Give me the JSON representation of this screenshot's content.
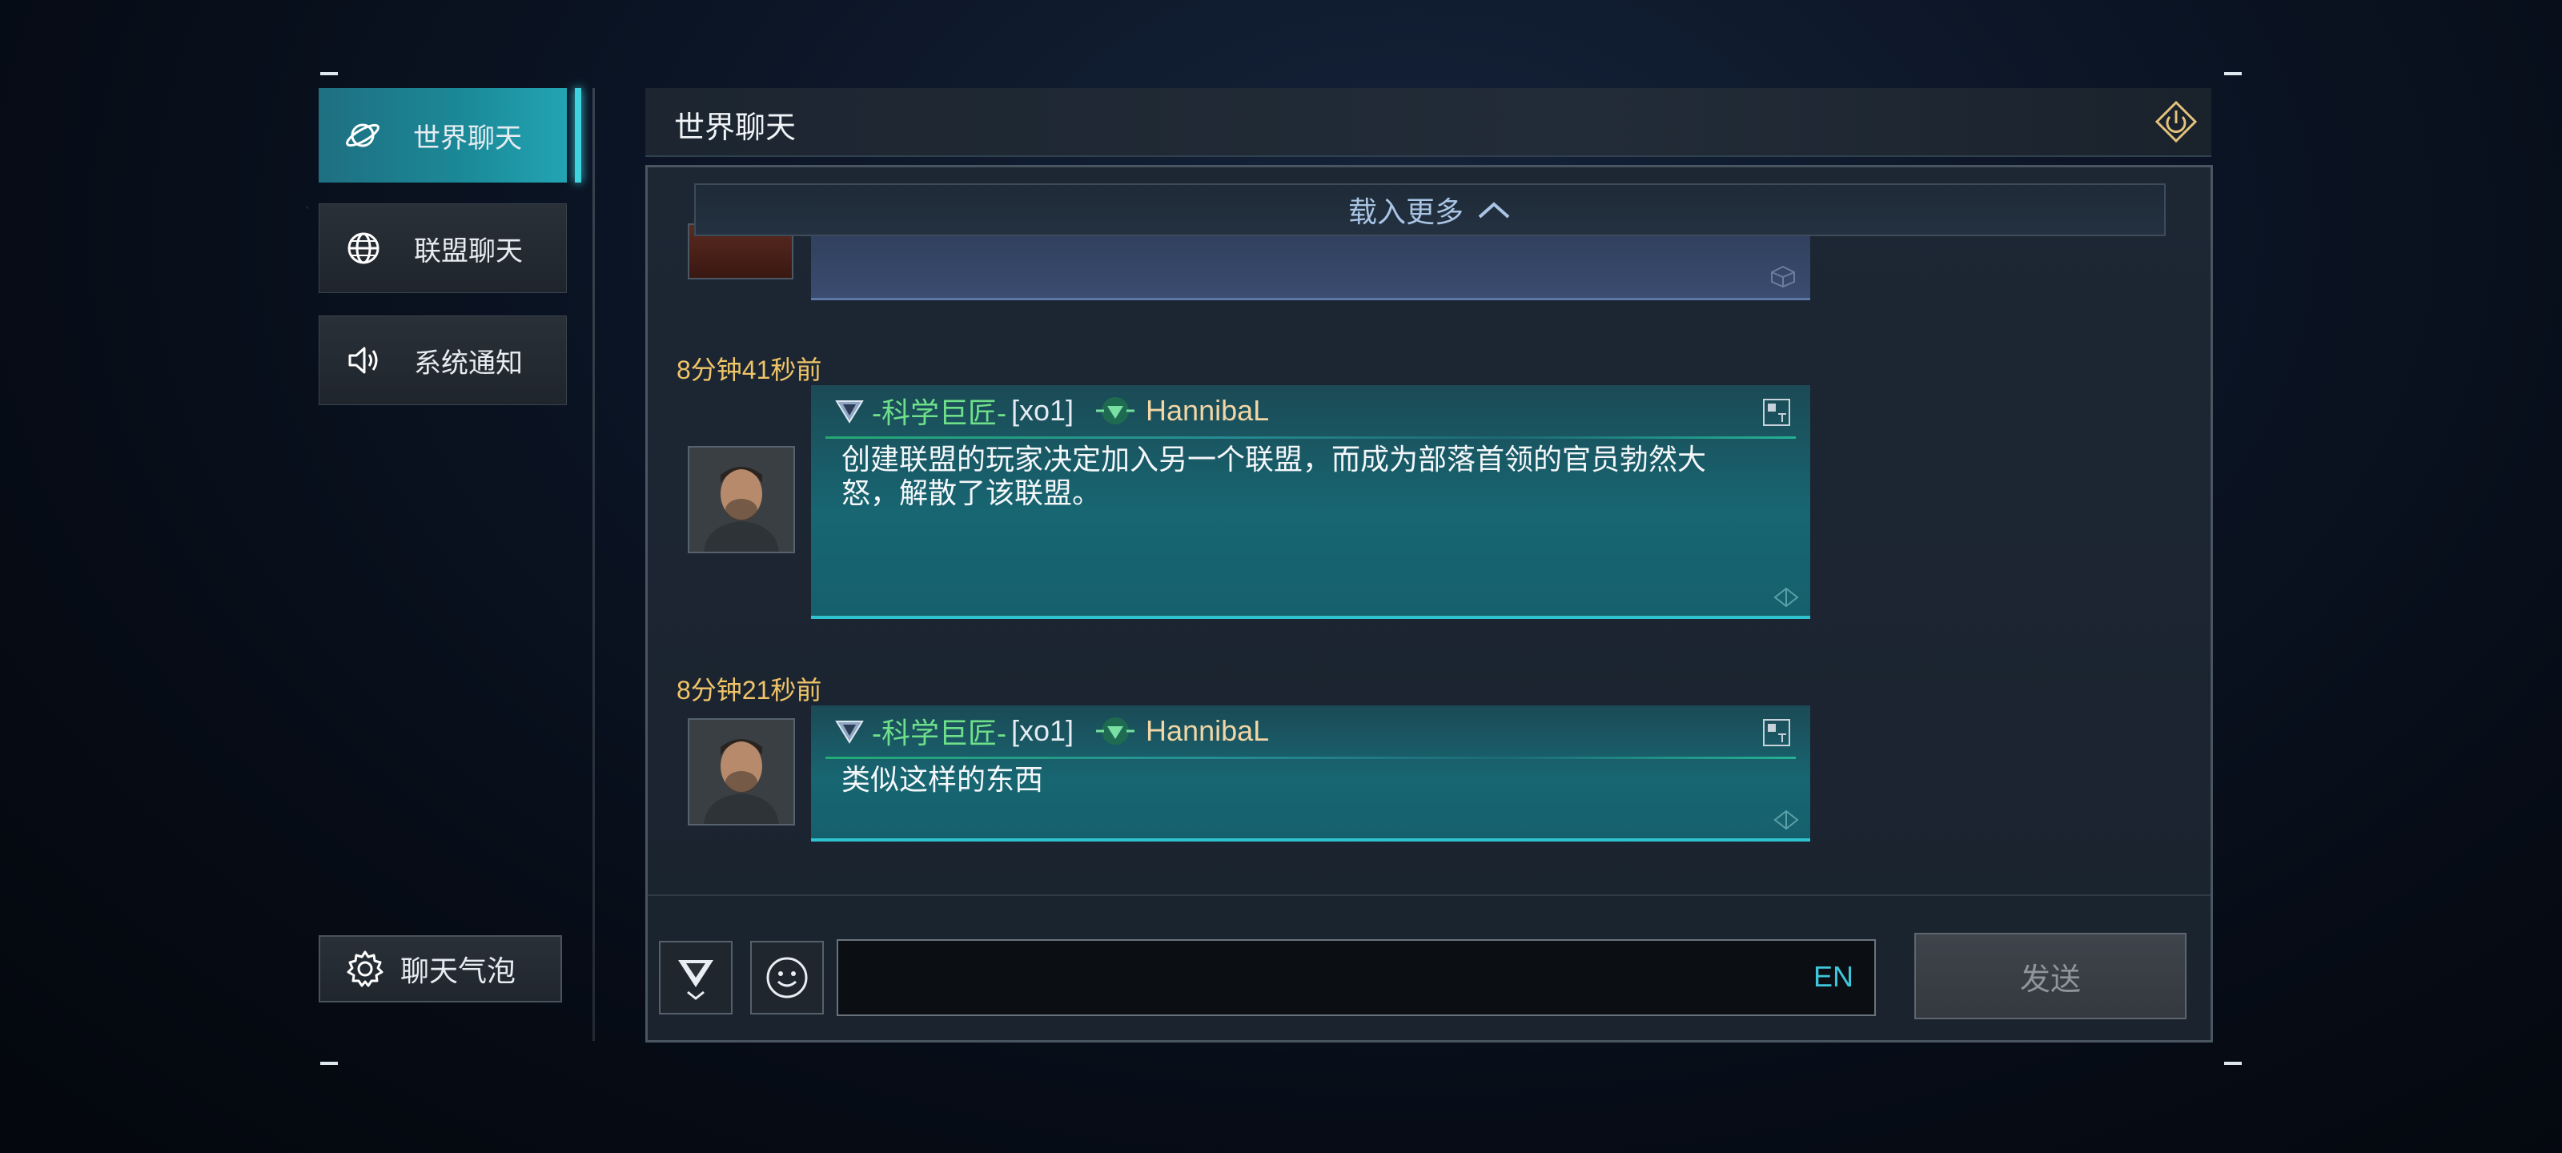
{
  "sidebar": {
    "items": [
      {
        "label": "世界聊天",
        "icon": "planet-icon",
        "active": true
      },
      {
        "label": "联盟聊天",
        "icon": "globe-icon",
        "active": false
      },
      {
        "label": "系统通知",
        "icon": "speaker-icon",
        "active": false
      }
    ],
    "bubble_label": "聊天气泡",
    "bubble_icon": "gear-icon"
  },
  "header": {
    "title": "世界聊天",
    "power_icon": "power-icon"
  },
  "chat": {
    "load_more": "载入更多",
    "messages": [
      {
        "time": "8分钟41秒前",
        "guild": "-科学巨匠-",
        "tag": "[xo1]",
        "player": "HannibaL",
        "text": "创建联盟的玩家决定加入另一个联盟，而成为部落首领的官员勃然大怒，解散了该联盟。"
      },
      {
        "time": "8分钟21秒前",
        "guild": "-科学巨匠-",
        "tag": "[xo1]",
        "player": "HannibaL",
        "text": "类似这样的东西"
      }
    ]
  },
  "input": {
    "value": "",
    "placeholder": "",
    "lang": "EN",
    "send_label": "发送"
  },
  "colors": {
    "accent": "#2fc3d0",
    "time": "#f0c468",
    "guild": "#6fe08a",
    "player": "#f2d6a6",
    "active_tab": "#1b8a99"
  }
}
